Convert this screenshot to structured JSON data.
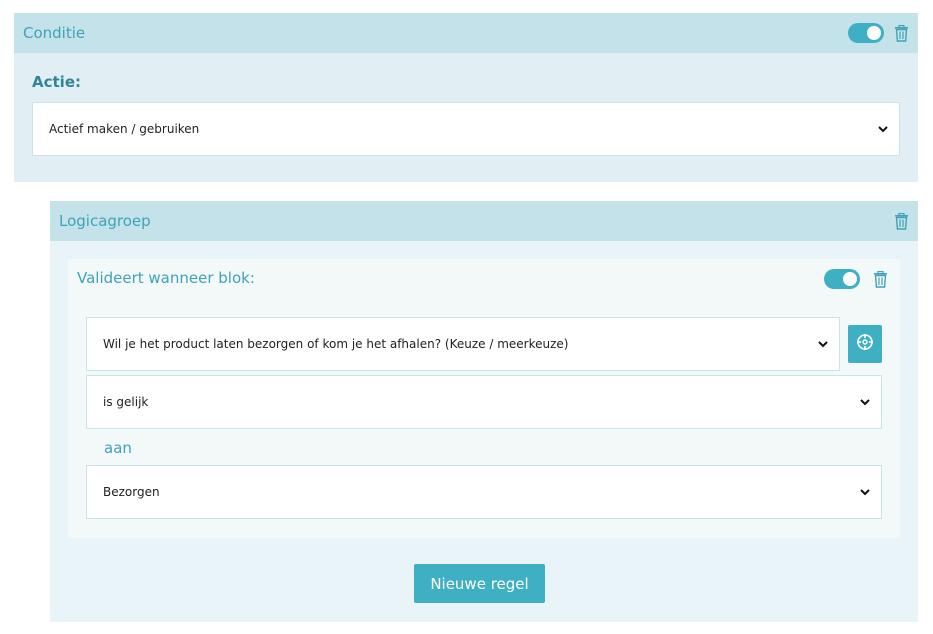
{
  "condition": {
    "title": "Conditie",
    "enabled": true,
    "action_label": "Actie:",
    "action_value": "Actief maken / gebruiken"
  },
  "logic_group": {
    "title": "Logicagroep",
    "block": {
      "title": "Valideert wanneer blok:",
      "enabled": true,
      "question_value": "Wil je het product laten bezorgen of kom je het afhalen? (Keuze / meerkeuze)",
      "operator_value": "is gelijk",
      "connector_label": "aan",
      "answer_value": "Bezorgen"
    },
    "new_rule_label": "Nieuwe regel"
  },
  "colors": {
    "accent": "#3fb0c4",
    "header_bg": "#c3e2ea",
    "panel_bg": "#e1eff4",
    "label_text": "#2f8597"
  },
  "icons": [
    "toggle-switch",
    "trash-icon",
    "chevron-down-icon",
    "crosshair-icon"
  ]
}
